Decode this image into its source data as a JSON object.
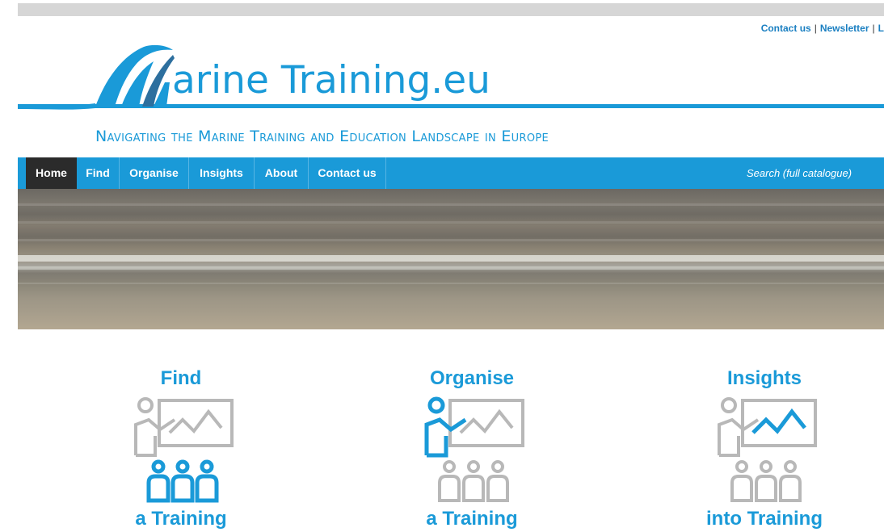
{
  "utility_links": [
    "Contact us",
    "Newsletter",
    "L"
  ],
  "brand": {
    "logo_text": "arine Training.eu",
    "tagline": "Navigating the Marine Training and Education Landscape in Europe"
  },
  "nav": {
    "items": [
      "Home",
      "Find",
      "Organise",
      "Insights",
      "About",
      "Contact us"
    ],
    "active": "Home",
    "search_text": "Search (full catalogue)"
  },
  "features": [
    {
      "title": "Find",
      "subtitle": "a Training",
      "icon": "training-audience-icon"
    },
    {
      "title": "Organise",
      "subtitle": "a Training",
      "icon": "training-presenter-icon"
    },
    {
      "title": "Insights",
      "subtitle": "into Training",
      "icon": "training-chart-icon"
    }
  ],
  "colors": {
    "accent": "#1a9ad8",
    "nav_active": "#2b2b2b",
    "icon_grey": "#b8b8b8"
  }
}
